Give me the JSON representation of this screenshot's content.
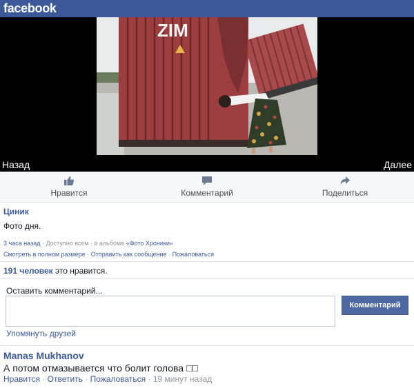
{
  "brand": {
    "logo_text": "facebook",
    "color": "#3b5998"
  },
  "photo_viewer": {
    "prev_label": "Назад",
    "next_label": "Далее",
    "photo_text": "ZIM"
  },
  "actions": [
    {
      "label": "Нравится",
      "icon": "thumbs-up-icon"
    },
    {
      "label": "Комментарий",
      "icon": "comment-bubble-icon"
    },
    {
      "label": "Поделиться",
      "icon": "share-arrow-icon"
    }
  ],
  "post": {
    "author": "Циник",
    "text": "Фото дня.",
    "meta": {
      "time": "3 часа назад",
      "privacy": "Доступно всем",
      "album_prefix": "в альбоме",
      "album": "«Фото Хроники»",
      "view_full": "Смотреть в полном размере",
      "send_message": "Отправить как сообщение",
      "report": "Пожаловаться"
    }
  },
  "likes": {
    "count_text": "191 человек",
    "suffix": "это нравится."
  },
  "comment_form": {
    "label": "Оставить комментарий...",
    "input_value": "",
    "button_label": "Комментарий",
    "mention_label": "Упомянуть друзей"
  },
  "comments": [
    {
      "author": "Manas Mukhanov",
      "text": "А потом отмазывается что болит голова □□",
      "like": "Нравится",
      "reply": "Ответить",
      "report": "Пожаловаться",
      "time": "19 минут назад"
    }
  ]
}
